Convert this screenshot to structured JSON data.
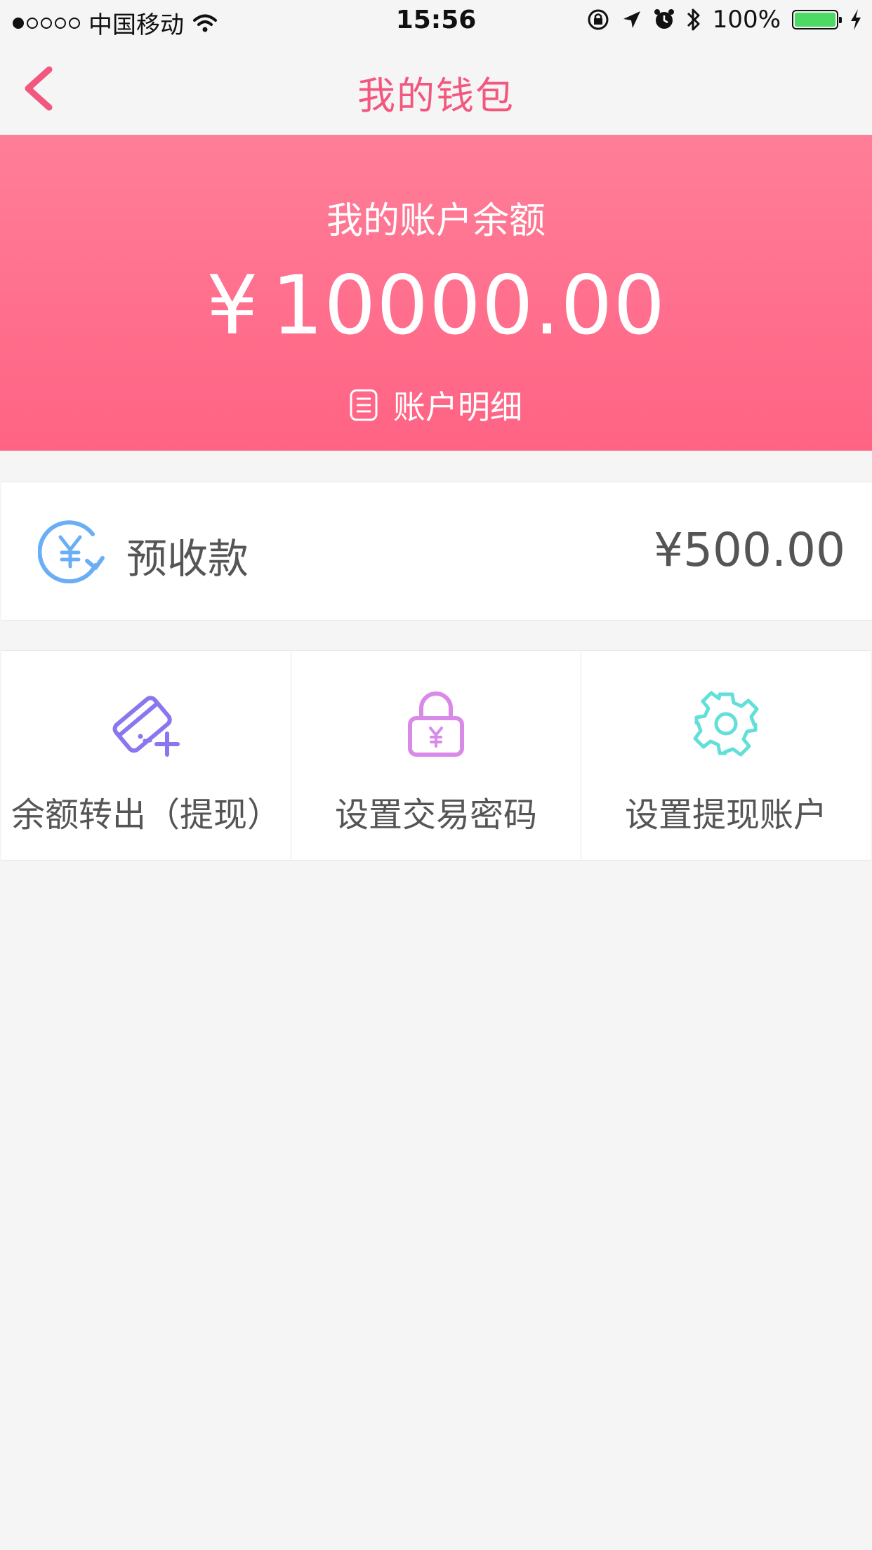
{
  "status_bar": {
    "carrier": "中国移动",
    "time": "15:56",
    "battery": "100%",
    "signal_strength": 1,
    "battery_level": 1.0
  },
  "nav": {
    "title": "我的钱包",
    "back_icon": "chevron-left-icon"
  },
  "account": {
    "title": "我的账户余额",
    "currency": "¥",
    "balance": "10000.00",
    "detail_label": "账户明细",
    "detail_icon": "list-icon"
  },
  "prepayment": {
    "label": "预收款",
    "currency": "¥",
    "value": "500.00",
    "icon": "yen-refresh-icon"
  },
  "actions": [
    {
      "label": "余额转出（提现）",
      "icon": "card-add-icon"
    },
    {
      "label": "设置交易密码",
      "icon": "lock-yen-icon"
    },
    {
      "label": "设置提现账户",
      "icon": "gear-icon"
    }
  ],
  "colors": {
    "brand": "#f2587e",
    "hero_top": "#ff7e98",
    "hero_bottom": "#ff6384",
    "prepay_icon": "#6aaef5",
    "action_card": "#8a76ef",
    "action_lock": "#d98ae9",
    "action_gear": "#62dfd8",
    "battery": "#4cd964"
  }
}
